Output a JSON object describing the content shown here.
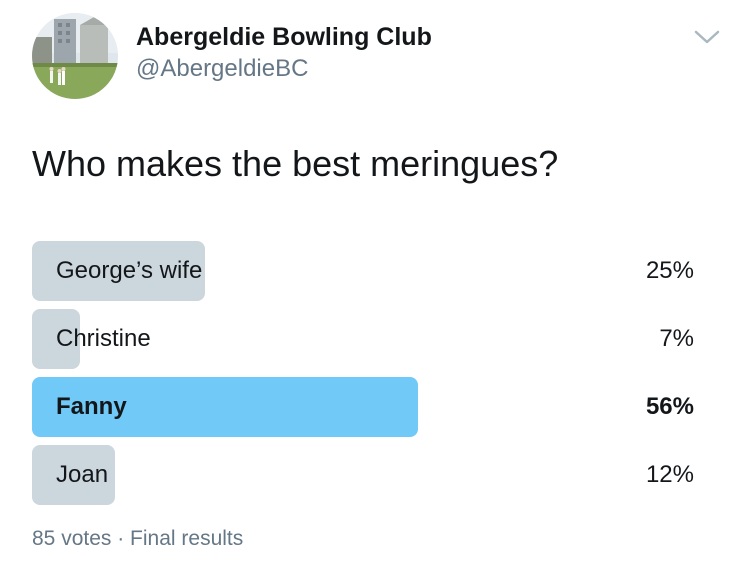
{
  "account": {
    "display_name": "Abergeldie Bowling Club",
    "handle": "@AbergeldieBC",
    "avatar_icon": "bowling-green-photo"
  },
  "menu_icon": "chevron-down-icon",
  "poll": {
    "question": "Who makes the best meringues?",
    "options": [
      {
        "label": "George’s wife",
        "percent": "25%",
        "fraction": 0.25,
        "winner": false
      },
      {
        "label": "Christine",
        "percent": "7%",
        "fraction": 0.07,
        "winner": false
      },
      {
        "label": "Fanny",
        "percent": "56%",
        "fraction": 0.56,
        "winner": true
      },
      {
        "label": "Joan",
        "percent": "12%",
        "fraction": 0.12,
        "winner": false
      }
    ],
    "footer": "85 votes · Final results"
  },
  "colors": {
    "bar_default": "#ccd6dd",
    "bar_winner": "#71c9f8",
    "text_primary": "#14171a",
    "text_secondary": "#657786"
  }
}
